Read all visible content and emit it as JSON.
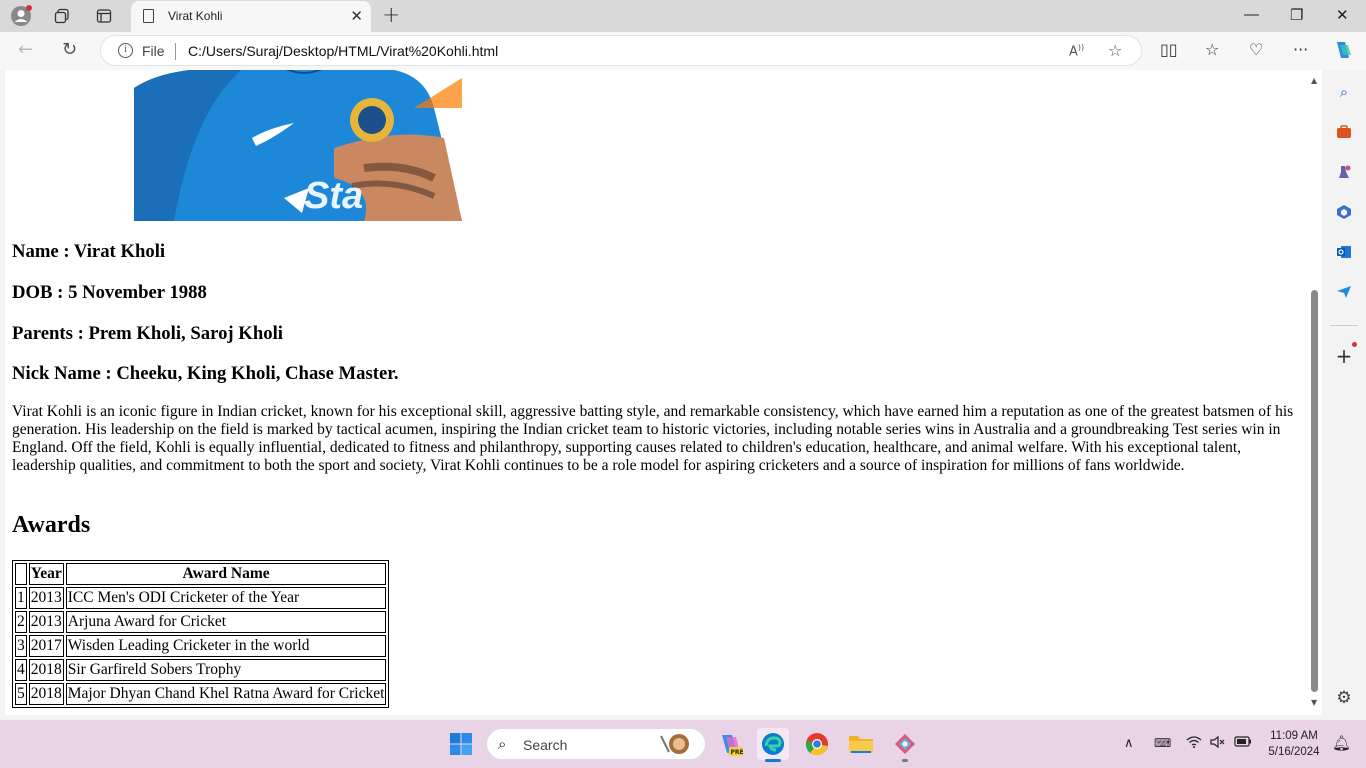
{
  "browser": {
    "tab_title": "Virat Kohli",
    "address_scheme_label": "File",
    "url": "C:/Users/Suraj/Desktop/HTML/Virat%20Kohli.html"
  },
  "page": {
    "name_line": "Name : Virat Kholi",
    "dob_line": "DOB : 5 November 1988",
    "parents_line": "Parents : Prem Kholi, Saroj Kholi",
    "nick_line": "Nick Name : Cheeku, King Kholi, Chase Master.",
    "bio": "Virat Kohli is an iconic figure in Indian cricket, known for his exceptional skill, aggressive batting style, and remarkable consistency, which have earned him a reputation as one of the greatest batsmen of his generation. His leadership on the field is marked by tactical acumen, inspiring the Indian cricket team to historic victories, including notable series wins in Australia and a groundbreaking Test series win in England. Off the field, Kohli is equally influential, dedicated to fitness and philanthropy, supporting causes related to children's education, healthcare, and animal welfare. With his exceptional talent, leadership qualities, and commitment to both the sport and society, Virat Kohli continues to be a role model for aspiring cricketers and a source of inspiration for millions of fans worldwide.",
    "awards_heading": "Awards",
    "awards_table": {
      "headers": [
        "",
        "Year",
        "Award Name"
      ],
      "rows": [
        [
          "1",
          "2013",
          "ICC Men's ODI Cricketer of the Year"
        ],
        [
          "2",
          "2013",
          "Arjuna Award for Cricket"
        ],
        [
          "3",
          "2017",
          "Wisden Leading Cricketer in the world"
        ],
        [
          "4",
          "2018",
          "Sir Garfireld Sobers Trophy"
        ],
        [
          "5",
          "2018",
          "Major Dhyan Chand Khel Ratna Award for Cricket"
        ]
      ]
    }
  },
  "taskbar": {
    "search_label": "Search",
    "time": "11:09 AM",
    "date": "5/16/2024"
  },
  "colors": {
    "jersey_blue": "#1e88d8",
    "taskbar_bg": "#e9d3e6",
    "edge_accent": "#0a7bd6"
  }
}
